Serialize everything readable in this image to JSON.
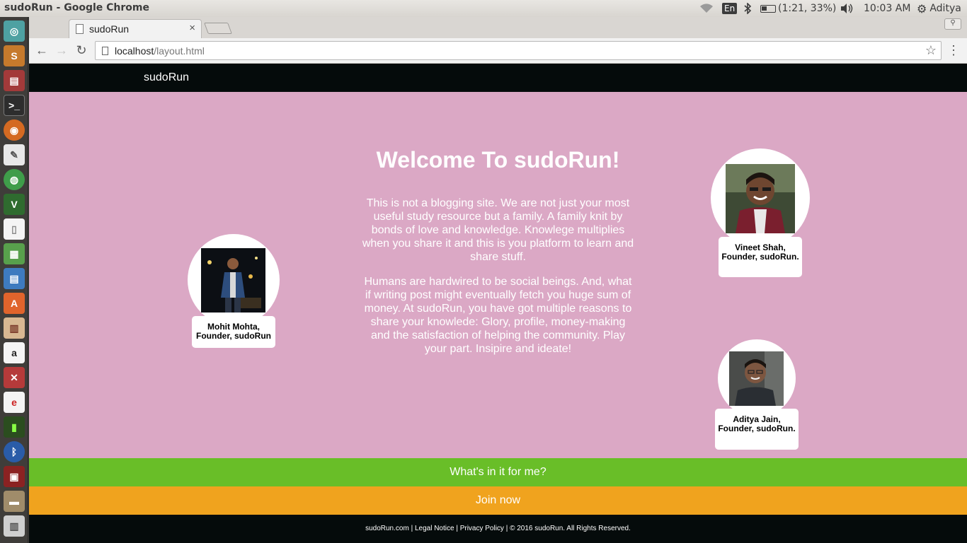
{
  "window": {
    "title": "sudoRun - Google Chrome"
  },
  "panel": {
    "input_method": "En",
    "battery": "(1:21, 33%)",
    "clock": "10:03 AM",
    "user": "Aditya"
  },
  "launcher": {
    "items": [
      "dash",
      "sublime-text",
      "files",
      "terminal",
      "firefox",
      "text-editor",
      "chrome",
      "vim",
      "document",
      "spreadsheet",
      "impress",
      "software-center",
      "presentation",
      "amazon",
      "settings",
      "viewer",
      "battery",
      "bluetooth",
      "workspace",
      "drive",
      "trash"
    ]
  },
  "browser": {
    "tab_title": "sudoRun",
    "tab_close": "×",
    "url_host": "localhost",
    "url_path": "/layout.html"
  },
  "page": {
    "brand": "sudoRun",
    "hero_title": "Welcome To sudoRun!",
    "paragraph1": "This is not a blogging site. We are not just your most useful study resource but a family. A family knit by bonds of love and knowledge. Knowlege multiplies when you share it and this is you platform to learn and share stuff.",
    "paragraph2": "Humans are hardwired to be social beings. And, what if writing post might eventually fetch you huge sum of money. At sudoRun, you have got multiple reasons to share your knowlede: Glory, profile, money-making and the satisfaction of helping the community. Play your part. Insipire and ideate!",
    "founders": {
      "mohit": "Mohit Mohta, Founder, sudoRun",
      "vineet": "Vineet Shah, Founder, sudoRun.",
      "aditya": "Aditya Jain, Founder, sudoRun."
    },
    "cta_benefits": "What's in it for me?",
    "cta_join": "Join now",
    "footer": "sudoRun.com | Legal Notice | Privacy Policy | © 2016 sudoRun. All Rights Reserved."
  },
  "colors": {
    "page_bg": "#dba8c5",
    "navbar_bg": "#050b0b",
    "cta_green": "#69be28",
    "cta_orange": "#f0a31e"
  }
}
